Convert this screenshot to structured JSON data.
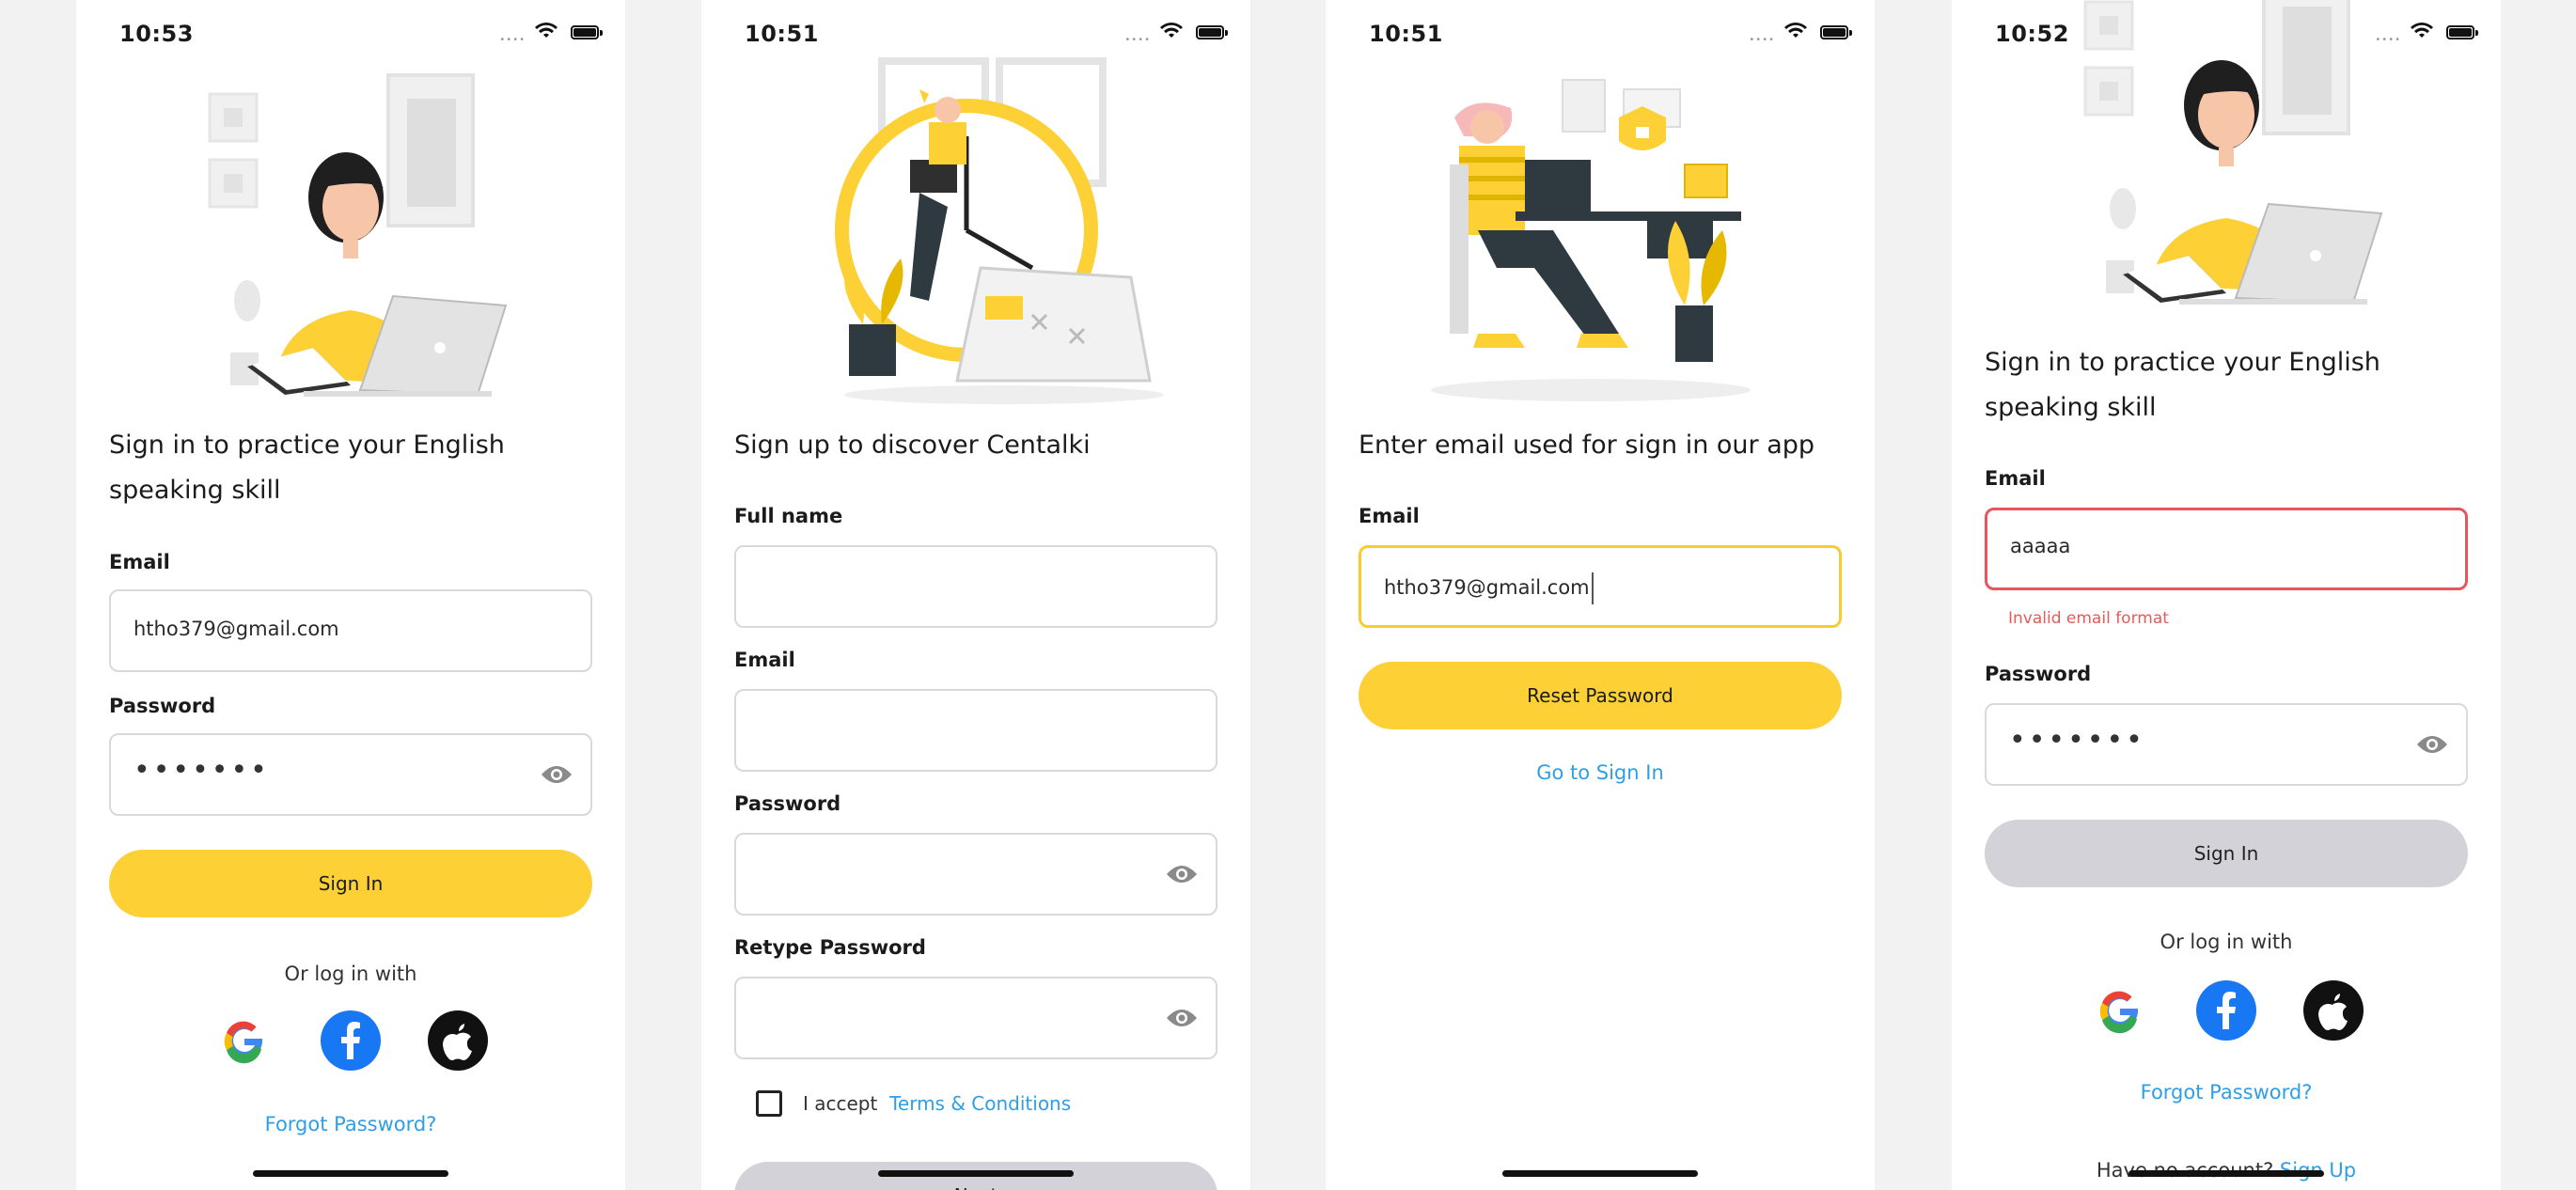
{
  "colors": {
    "accent": "#fdd035",
    "link": "#2f9ee8",
    "error": "#e35b5b",
    "disabled": "#d2d2d8"
  },
  "icons": [
    "wifi-icon",
    "battery-icon",
    "eye-icon",
    "google-icon",
    "facebook-icon",
    "apple-icon"
  ],
  "screens": [
    {
      "time": "10:53",
      "heading": "Sign in to practice your English speaking skill",
      "email_label": "Email",
      "email_value": "htho379@gmail.com",
      "password_label": "Password",
      "password_value": "•••••••",
      "sign_in": "Sign In",
      "or_log_in": "Or log in with",
      "forgot": "Forgot Password?"
    },
    {
      "time": "10:51",
      "heading": "Sign up to discover Centalki",
      "full_name_label": "Full name",
      "email_label": "Email",
      "password_label": "Password",
      "retype_label": "Retype Password",
      "accept_text": "I accept",
      "terms_link": "Terms & Conditions",
      "next": "Next"
    },
    {
      "time": "10:51",
      "heading": "Enter email used for sign in our app",
      "email_label": "Email",
      "email_value": "htho379@gmail.com",
      "reset": "Reset Password",
      "go_sign_in": "Go to Sign In"
    },
    {
      "time": "10:52",
      "heading": "Sign in to practice your English speaking skill",
      "email_label": "Email",
      "email_value": "aaaaa",
      "error": "Invalid email format",
      "password_label": "Password",
      "password_value": "•••••••",
      "sign_in": "Sign In",
      "or_log_in": "Or log in with",
      "forgot": "Forgot Password?",
      "no_account": "Have no account?",
      "sign_up": "Sign Up"
    }
  ]
}
